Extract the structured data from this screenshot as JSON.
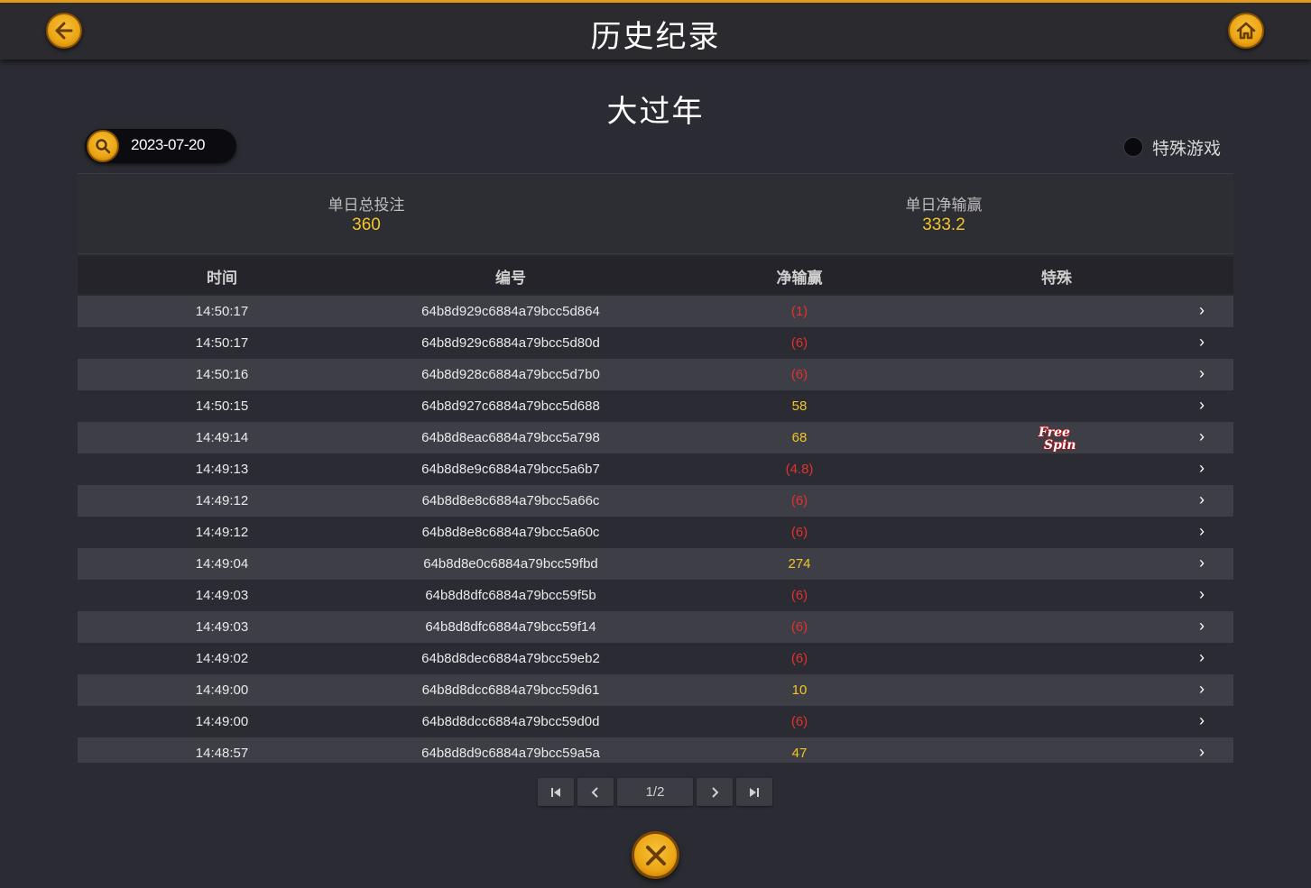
{
  "header": {
    "title": "历史纪录"
  },
  "game_title": "大过年",
  "filter": {
    "date": "2023-07-20",
    "special_label": "特殊游戏"
  },
  "summary": {
    "total_bet_label": "单日总投注",
    "total_bet_value": "360",
    "net_label": "单日净输赢",
    "net_value": "333.2"
  },
  "table": {
    "headers": {
      "time": "时间",
      "id": "编号",
      "net": "净输赢",
      "special": "特殊"
    },
    "rows": [
      {
        "time": "14:50:17",
        "id": "64b8d929c6884a79bcc5d864",
        "net": "(1)"
      },
      {
        "time": "14:50:17",
        "id": "64b8d929c6884a79bcc5d80d",
        "net": "(6)"
      },
      {
        "time": "14:50:16",
        "id": "64b8d928c6884a79bcc5d7b0",
        "net": "(6)"
      },
      {
        "time": "14:50:15",
        "id": "64b8d927c6884a79bcc5d688",
        "net": "58"
      },
      {
        "time": "14:49:14",
        "id": "64b8d8eac6884a79bcc5a798",
        "net": "68",
        "special": "Free Spin"
      },
      {
        "time": "14:49:13",
        "id": "64b8d8e9c6884a79bcc5a6b7",
        "net": "(4.8)"
      },
      {
        "time": "14:49:12",
        "id": "64b8d8e8c6884a79bcc5a66c",
        "net": "(6)"
      },
      {
        "time": "14:49:12",
        "id": "64b8d8e8c6884a79bcc5a60c",
        "net": "(6)"
      },
      {
        "time": "14:49:04",
        "id": "64b8d8e0c6884a79bcc59fbd",
        "net": "274"
      },
      {
        "time": "14:49:03",
        "id": "64b8d8dfc6884a79bcc59f5b",
        "net": "(6)"
      },
      {
        "time": "14:49:03",
        "id": "64b8d8dfc6884a79bcc59f14",
        "net": "(6)"
      },
      {
        "time": "14:49:02",
        "id": "64b8d8dec6884a79bcc59eb2",
        "net": "(6)"
      },
      {
        "time": "14:49:00",
        "id": "64b8d8dcc6884a79bcc59d61",
        "net": "10"
      },
      {
        "time": "14:49:00",
        "id": "64b8d8dcc6884a79bcc59d0d",
        "net": "(6)"
      },
      {
        "time": "14:48:57",
        "id": "64b8d8d9c6884a79bcc59a5a",
        "net": "47"
      }
    ]
  },
  "pagination": {
    "page_text": "1/2"
  },
  "colors": {
    "accent": "#eba514",
    "negative": "#e2322c",
    "positive": "#f3c525"
  },
  "icons": {
    "back": "arrow-left-icon",
    "home": "home-icon",
    "search": "search-icon",
    "row_detail": "chevron-right-icon",
    "close": "close-icon"
  }
}
